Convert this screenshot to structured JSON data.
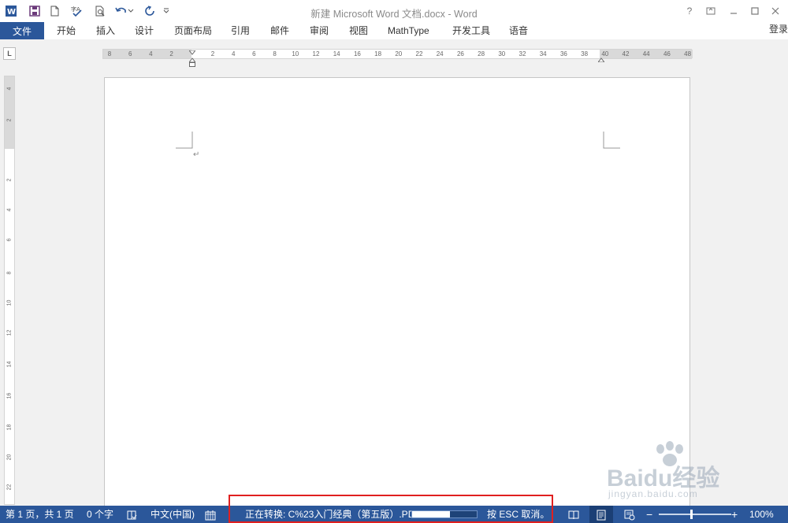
{
  "window": {
    "title": "新建 Microsoft Word 文档.docx - Word",
    "help": "?",
    "controls": [
      "restore-ribbon",
      "minimize",
      "maximize",
      "close"
    ]
  },
  "ribbon": {
    "file_tab": "文件",
    "tabs": [
      "开始",
      "插入",
      "设计",
      "页面布局",
      "引用",
      "邮件",
      "审阅",
      "视图",
      "MathType",
      "开发工具",
      "语音"
    ],
    "signin": "登录"
  },
  "ruler": {
    "horizontal": [
      "8",
      "6",
      "4",
      "2",
      "2",
      "4",
      "6",
      "8",
      "10",
      "12",
      "14",
      "16",
      "18",
      "20",
      "22",
      "24",
      "26",
      "28",
      "30",
      "32",
      "34",
      "36",
      "38",
      "40",
      "42",
      "44",
      "46",
      "48"
    ],
    "vertical": [
      "4",
      "2",
      "2",
      "4",
      "6",
      "8",
      "10",
      "12",
      "14",
      "16",
      "18",
      "20",
      "22"
    ]
  },
  "document": {
    "paragraph_mark": "↵"
  },
  "statusbar": {
    "page_info": "第 1 页，共 1 页",
    "word_count": "0 个字",
    "language": "中文(中国)",
    "converting": "正在转换: C%23入门经典（第五版）.PDF",
    "conversion_progress": 0.58,
    "esc_hint": "按 ESC 取消。",
    "zoom_minus": "−",
    "zoom_plus": "+",
    "zoom": "100%"
  },
  "watermark": {
    "brand": "Baidu经验",
    "url": "jingyan.baidu.com"
  },
  "colors": {
    "accent": "#2b579a",
    "highlight": "#e02020"
  }
}
